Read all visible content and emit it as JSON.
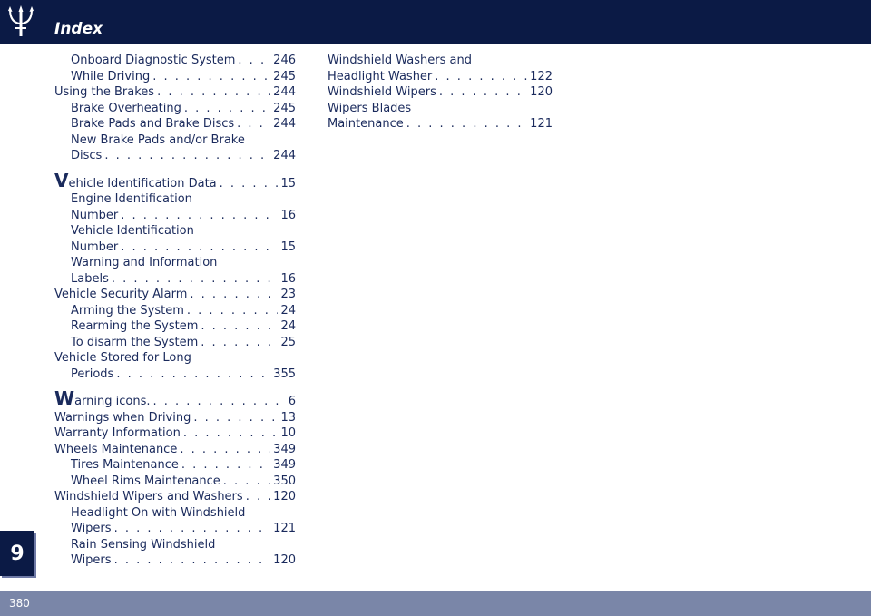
{
  "header": {
    "title": "Index"
  },
  "chapter_tab": "9",
  "footer": {
    "page_number": "380"
  },
  "column1": [
    {
      "level": 2,
      "lines": [
        {
          "term": "Onboard Diagnostic System",
          "page": "246"
        }
      ]
    },
    {
      "level": 2,
      "lines": [
        {
          "term": "While Driving",
          "page": "245"
        }
      ]
    },
    {
      "level": 1,
      "lines": [
        {
          "term": "Using the Brakes",
          "page": "244"
        }
      ]
    },
    {
      "level": 2,
      "lines": [
        {
          "term": "Brake Overheating",
          "page": "245"
        }
      ]
    },
    {
      "level": 2,
      "lines": [
        {
          "term": "Brake Pads and Brake Discs",
          "page": "244"
        }
      ]
    },
    {
      "level": 2,
      "lines": [
        {
          "term": "New Brake Pads and/or Brake"
        },
        {
          "term": "Discs",
          "page": "244"
        }
      ]
    },
    {
      "level": 1,
      "letter": true,
      "first": "V",
      "lines": [
        {
          "term": "ehicle Identification Data",
          "page": "15"
        }
      ]
    },
    {
      "level": 2,
      "lines": [
        {
          "term": "Engine Identification"
        },
        {
          "term": "Number",
          "page": "16"
        }
      ]
    },
    {
      "level": 2,
      "lines": [
        {
          "term": "Vehicle Identification"
        },
        {
          "term": "Number",
          "page": "15"
        }
      ]
    },
    {
      "level": 2,
      "lines": [
        {
          "term": "Warning and Information"
        },
        {
          "term": "Labels",
          "page": "16"
        }
      ]
    },
    {
      "level": 1,
      "lines": [
        {
          "term": "Vehicle Security Alarm",
          "page": "23"
        }
      ]
    },
    {
      "level": 2,
      "lines": [
        {
          "term": "Arming the System",
          "page": "24"
        }
      ]
    },
    {
      "level": 2,
      "lines": [
        {
          "term": "Rearming the System",
          "page": "24"
        }
      ]
    },
    {
      "level": 2,
      "lines": [
        {
          "term": "To disarm the System",
          "page": "25"
        }
      ]
    },
    {
      "level": 1,
      "lines": [
        {
          "term": "Vehicle Stored for Long"
        }
      ]
    },
    {
      "level": 2,
      "lines": [
        {
          "term": "Periods",
          "page": "355"
        }
      ]
    },
    {
      "level": 1,
      "letter": true,
      "first": "W",
      "lines": [
        {
          "term": "arning icons.",
          "page": "6"
        }
      ]
    },
    {
      "level": 1,
      "lines": [
        {
          "term": "Warnings when Driving",
          "page": "13"
        }
      ]
    },
    {
      "level": 1,
      "lines": [
        {
          "term": "Warranty Information",
          "page": "10"
        }
      ]
    },
    {
      "level": 1,
      "lines": [
        {
          "term": "Wheels Maintenance",
          "page": "349"
        }
      ]
    },
    {
      "level": 2,
      "lines": [
        {
          "term": "Tires Maintenance",
          "page": "349"
        }
      ]
    },
    {
      "level": 2,
      "lines": [
        {
          "term": "Wheel Rims Maintenance",
          "page": "350"
        }
      ]
    },
    {
      "level": 1,
      "lines": [
        {
          "term": "Windshield Wipers and Washers",
          "page": "120"
        }
      ]
    },
    {
      "level": 2,
      "lines": [
        {
          "term": "Headlight On with Windshield"
        },
        {
          "term": "Wipers",
          "page": "121"
        }
      ]
    },
    {
      "level": 2,
      "lines": [
        {
          "term": "Rain Sensing Windshield"
        },
        {
          "term": "Wipers",
          "page": "120"
        }
      ]
    }
  ],
  "column2": [
    {
      "level": 1,
      "lines": [
        {
          "term": "Windshield Washers and"
        },
        {
          "term": "Headlight Washer",
          "page": "122"
        }
      ]
    },
    {
      "level": 1,
      "lines": [
        {
          "term": "Windshield Wipers",
          "page": "120"
        }
      ]
    },
    {
      "level": 1,
      "lines": [
        {
          "term": "Wipers Blades"
        },
        {
          "term": "Maintenance",
          "page": "121"
        }
      ]
    }
  ]
}
